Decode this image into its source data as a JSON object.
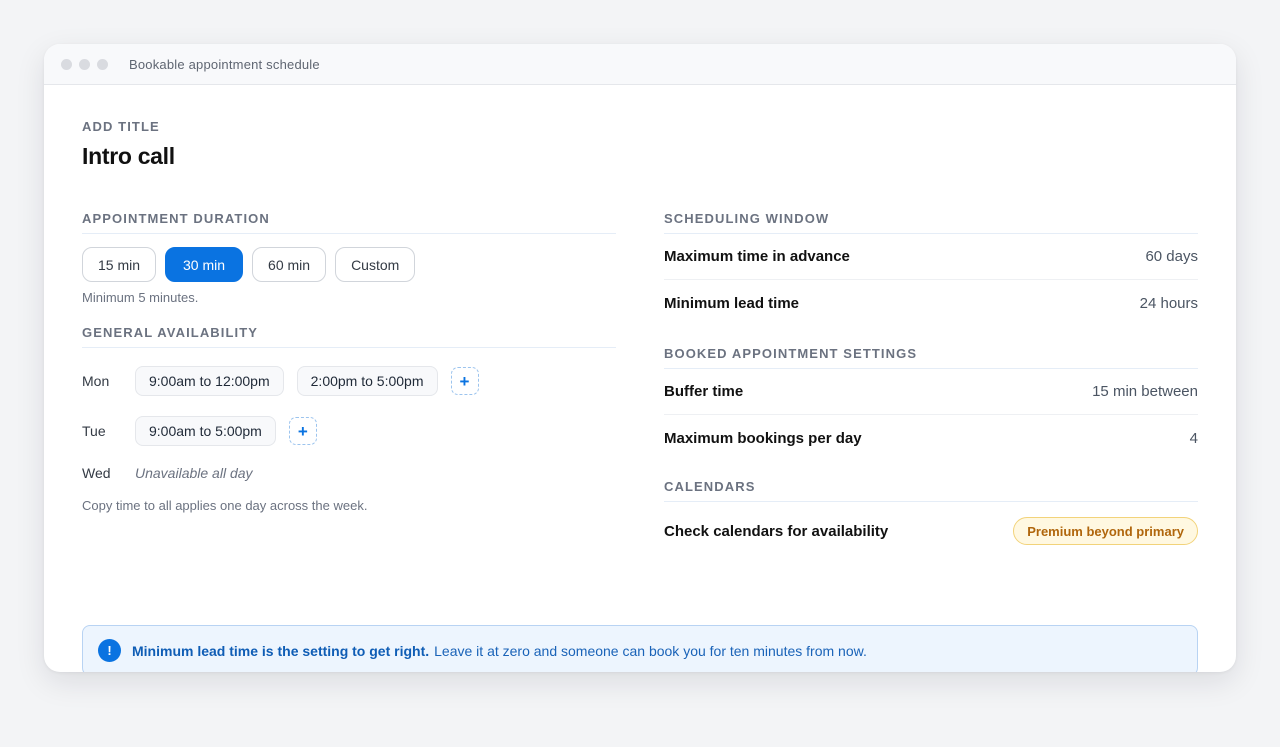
{
  "window": {
    "title": "Bookable appointment schedule"
  },
  "title_section": {
    "label": "ADD TITLE",
    "value": "Intro call"
  },
  "duration": {
    "heading": "APPOINTMENT DURATION",
    "options": [
      "15 min",
      "30 min",
      "60 min",
      "Custom"
    ],
    "selected": "30 min",
    "hint": "Minimum 5 minutes."
  },
  "availability": {
    "heading": "GENERAL AVAILABILITY",
    "days": [
      {
        "day": "Mon",
        "slots": [
          "9:00am to 12:00pm",
          "2:00pm to 5:00pm"
        ]
      },
      {
        "day": "Tue",
        "slots": [
          "9:00am to 5:00pm"
        ]
      },
      {
        "day": "Wed",
        "unavailable": "Unavailable all day"
      }
    ],
    "add_icon": "plus-icon",
    "hint": "Copy time to all applies one day across the week."
  },
  "scheduling_window": {
    "heading": "SCHEDULING WINDOW",
    "rows": [
      {
        "label": "Maximum time in advance",
        "value": "60 days"
      },
      {
        "label": "Minimum lead time",
        "value": "24 hours"
      }
    ]
  },
  "booked_settings": {
    "heading": "BOOKED APPOINTMENT SETTINGS",
    "rows": [
      {
        "label": "Buffer time",
        "value": "15 min between"
      },
      {
        "label": "Maximum bookings per day",
        "value": "4"
      }
    ]
  },
  "calendars": {
    "heading": "CALENDARS",
    "row_label": "Check calendars for availability",
    "badge": "Premium beyond primary"
  },
  "callout": {
    "icon": "info-icon",
    "icon_glyph": "!",
    "strong": "Minimum lead time is the setting to get right.",
    "text": "Leave it at zero and someone can book you for ten minutes from now."
  },
  "colors": {
    "accent": "#0a73e1",
    "badge_text": "#b0660c",
    "callout_bg": "#edf5fe"
  }
}
